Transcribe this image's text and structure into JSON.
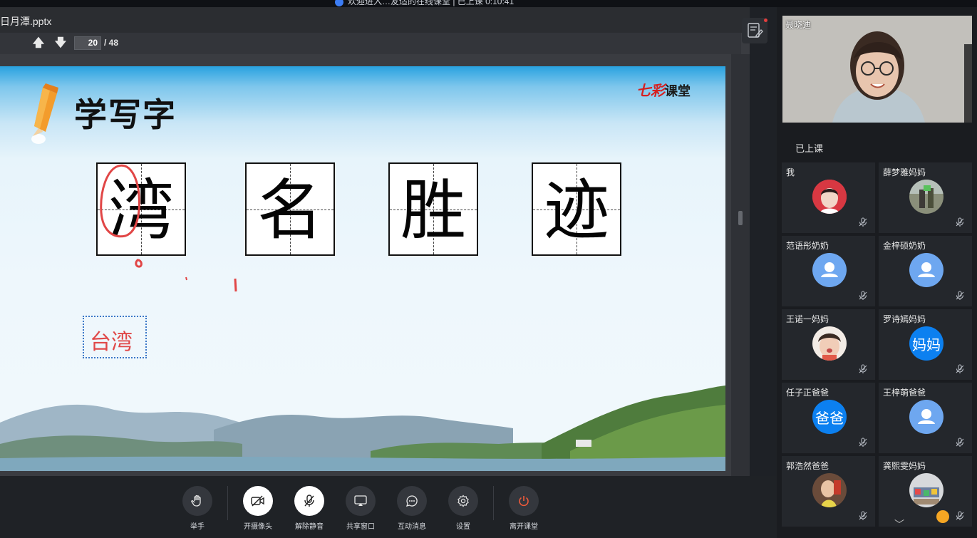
{
  "window": {
    "title": "欢迎进入…友适的在线课堂 | 已上课 0:10:41"
  },
  "presentation": {
    "filename": "日月潭.pptx",
    "current_page": "20",
    "total_pages": "/ 48"
  },
  "slide": {
    "title": "学写字",
    "brand_a": "七彩",
    "brand_b": "课堂",
    "characters": [
      "湾",
      "名",
      "胜",
      "迹"
    ],
    "answer": "台湾"
  },
  "controls": {
    "raise_hand": "举手",
    "camera": "开摄像头",
    "unmute": "解除静音",
    "share": "共享窗口",
    "chat": "互动消息",
    "settings": "设置",
    "leave": "离开课堂"
  },
  "sidebar": {
    "teacher_name": "聂晓迪",
    "status": "已上课",
    "participants": [
      {
        "name": "我",
        "avatar": "photo-red"
      },
      {
        "name": "薛梦雅妈妈",
        "avatar": "photo-outdoor"
      },
      {
        "name": "范语彤奶奶",
        "avatar": "default-user"
      },
      {
        "name": "金梓硕奶奶",
        "avatar": "default-user"
      },
      {
        "name": "王诺一妈妈",
        "avatar": "photo-child"
      },
      {
        "name": "罗诗嫣妈妈",
        "avatar": "text",
        "avatar_text": "妈妈"
      },
      {
        "name": "任子正爸爸",
        "avatar": "text",
        "avatar_text": "爸爸"
      },
      {
        "name": "王梓萌爸爸",
        "avatar": "default-user"
      },
      {
        "name": "郭浩然爸爸",
        "avatar": "photo-child2"
      },
      {
        "name": "龚熙雯妈妈",
        "avatar": "photo-toys"
      }
    ]
  },
  "colors": {
    "accent_blue": "#0c80f0",
    "leave_red": "#f05a3a",
    "annotation_red": "#e04848"
  }
}
